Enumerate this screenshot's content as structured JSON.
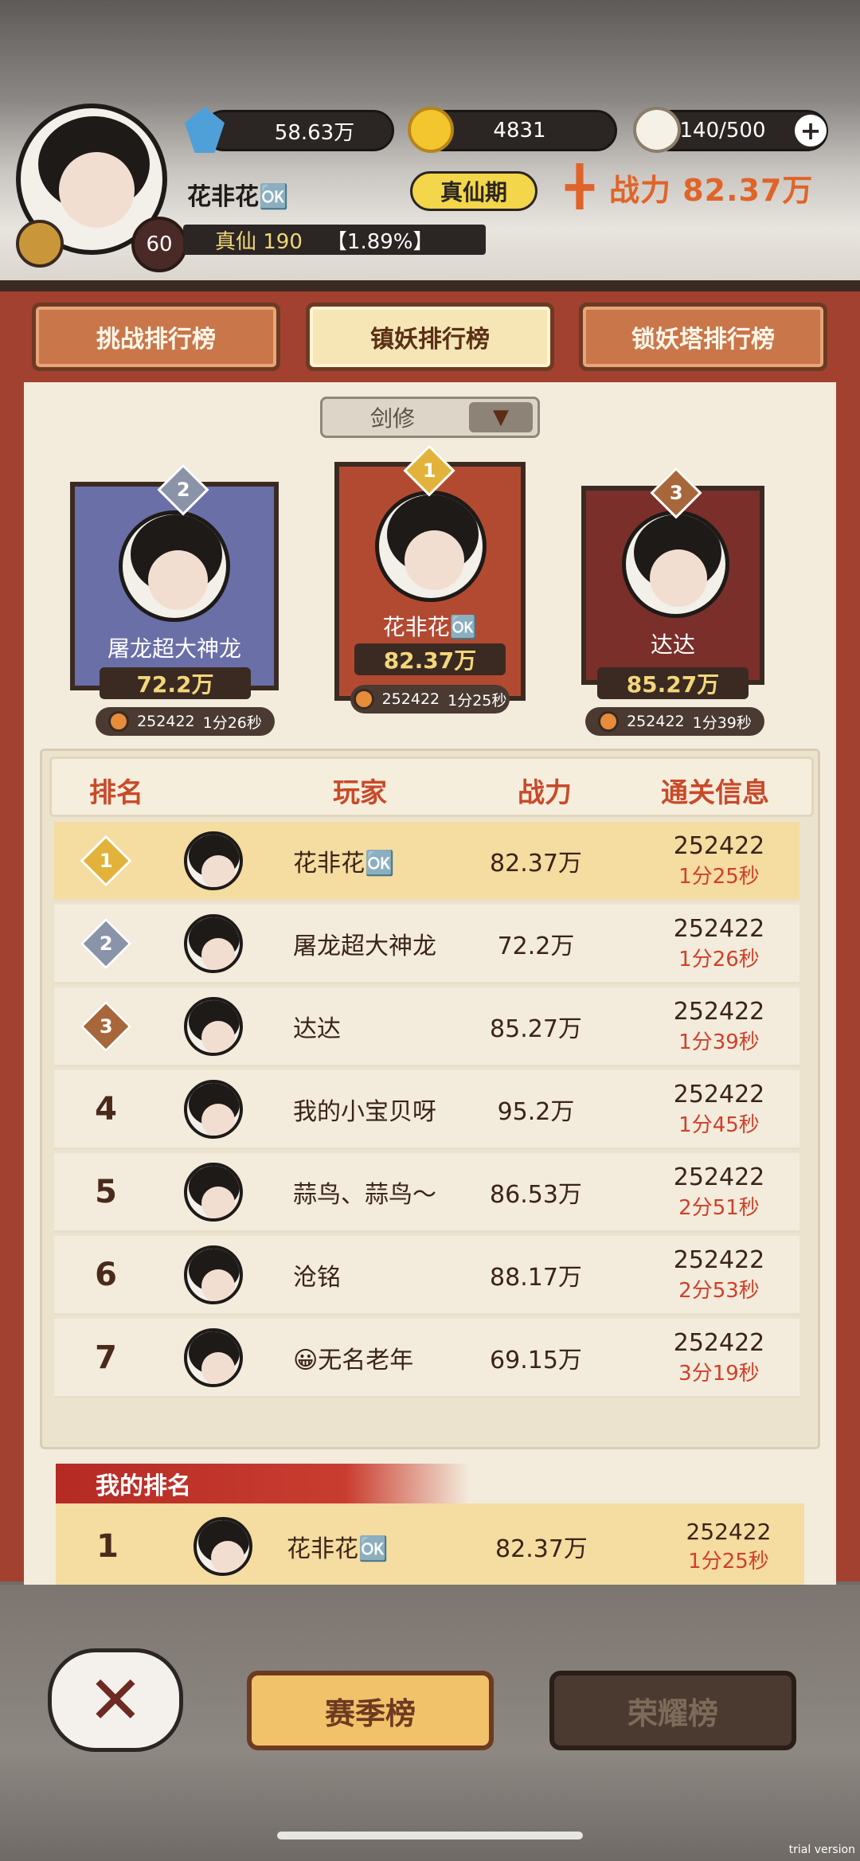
{
  "header": {
    "player_name": "花非花🆗",
    "level": "60",
    "realm_level": "真仙 190",
    "exp_percent": "【1.89%】",
    "realm_stage": "真仙期",
    "power_label": "战力 82.37万",
    "resources": {
      "gems": "58.63万",
      "gold": "4831",
      "stamina": "140/500"
    }
  },
  "tabs": [
    {
      "label": "挑战排行榜",
      "active": false
    },
    {
      "label": "镇妖排行榜",
      "active": true
    },
    {
      "label": "锁妖塔排行榜",
      "active": false
    }
  ],
  "filter": {
    "selected": "剑修"
  },
  "podium": [
    {
      "rank": "2",
      "name": "屠龙超大神龙",
      "power": "72.2万",
      "score": "252422",
      "time": "1分26秒"
    },
    {
      "rank": "1",
      "name": "花非花🆗",
      "power": "82.37万",
      "score": "252422",
      "time": "1分25秒"
    },
    {
      "rank": "3",
      "name": "达达",
      "power": "85.27万",
      "score": "252422",
      "time": "1分39秒"
    }
  ],
  "table": {
    "headers": [
      "排名",
      "玩家",
      "战力",
      "通关信息"
    ],
    "rows": [
      {
        "rank": "1",
        "name": "花非花🆗",
        "power": "82.37万",
        "score": "252422",
        "time": "1分25秒"
      },
      {
        "rank": "2",
        "name": "屠龙超大神龙",
        "power": "72.2万",
        "score": "252422",
        "time": "1分26秒"
      },
      {
        "rank": "3",
        "name": "达达",
        "power": "85.27万",
        "score": "252422",
        "time": "1分39秒"
      },
      {
        "rank": "4",
        "name": "我的小宝贝呀",
        "power": "95.2万",
        "score": "252422",
        "time": "1分45秒"
      },
      {
        "rank": "5",
        "name": "蒜鸟、蒜鸟～",
        "power": "86.53万",
        "score": "252422",
        "time": "2分51秒"
      },
      {
        "rank": "6",
        "name": "沧铭",
        "power": "88.17万",
        "score": "252422",
        "time": "2分53秒"
      },
      {
        "rank": "7",
        "name": "😀无名老年",
        "power": "69.15万",
        "score": "252422",
        "time": "3分19秒"
      }
    ]
  },
  "my_rank": {
    "label": "我的排名",
    "rank": "1",
    "name": "花非花🆗",
    "power": "82.37万",
    "score": "252422",
    "time": "1分25秒"
  },
  "bottom": {
    "season_button": "赛季榜",
    "honor_button": "荣耀榜"
  },
  "watermark": "trial version",
  "colors": {
    "panel_red": "#a24130",
    "gold": "#f5dca0",
    "accent_orange": "#e0642a",
    "time_red": "#d0402a"
  }
}
